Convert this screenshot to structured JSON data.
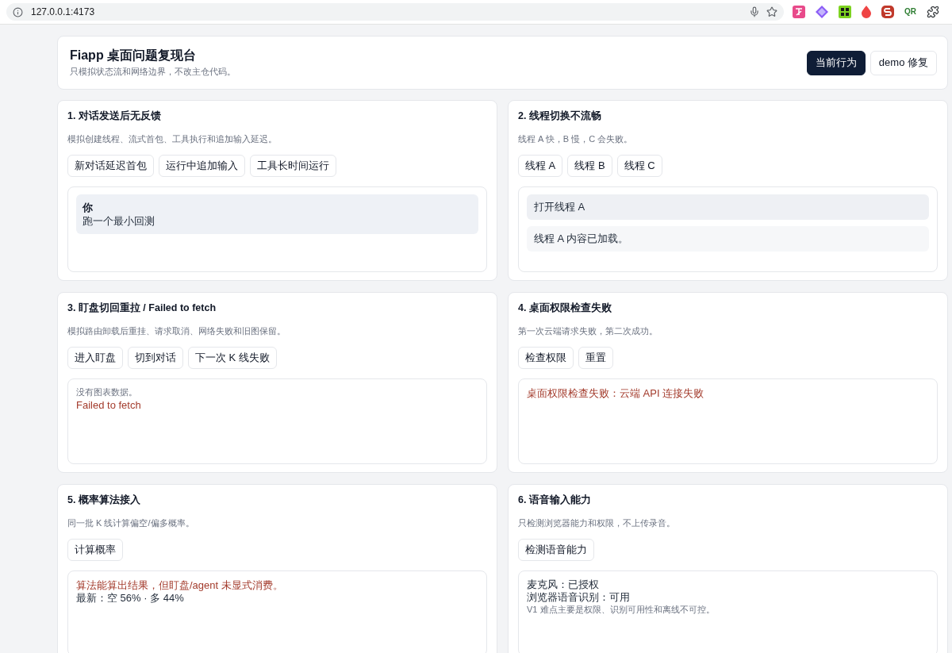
{
  "browser": {
    "url": "127.0.0.1:4173",
    "extension_label": "QR"
  },
  "header": {
    "title": "Fiapp 桌面问题复现台",
    "subtitle": "只模拟状态流和网络边界，不改主仓代码。",
    "mode_buttons": [
      {
        "label": "当前行为",
        "selected": true
      },
      {
        "label": "demo 修复",
        "selected": false
      }
    ]
  },
  "panels": [
    {
      "title": "1. 对话发送后无反馈",
      "description": "模拟创建线程、流式首包、工具执行和追加输入延迟。",
      "actions": [
        "新对话延迟首包",
        "运行中追加输入",
        "工具长时间运行"
      ],
      "output": [
        {
          "kind": "user_message",
          "author": "你",
          "text": "跑一个最小回测"
        }
      ]
    },
    {
      "title": "2. 线程切换不流畅",
      "description": "线程 A 快，B 慢，C 会失败。",
      "actions": [
        "线程 A",
        "线程 B",
        "线程 C"
      ],
      "output": [
        {
          "kind": "user_message",
          "text": "打开线程 A"
        },
        {
          "kind": "assistant_message",
          "text": "线程 A 内容已加载。"
        }
      ]
    },
    {
      "title": "3. 盯盘切回重拉 / Failed to fetch",
      "description": "模拟路由卸载后重挂、请求取消、网络失败和旧图保留。",
      "actions": [
        "进入盯盘",
        "切到对话",
        "下一次 K 线失败"
      ],
      "output": [
        {
          "kind": "note",
          "text": "没有图表数据。"
        },
        {
          "kind": "error",
          "text": "Failed to fetch"
        }
      ]
    },
    {
      "title": "4. 桌面权限检查失败",
      "description": "第一次云端请求失败，第二次成功。",
      "actions": [
        "检查权限",
        "重置"
      ],
      "output": [
        {
          "kind": "error",
          "text": "桌面权限检查失败：云端 API 连接失败"
        }
      ]
    },
    {
      "title": "5. 概率算法接入",
      "description": "同一批 K 线计算偏空/偏多概率。",
      "actions": [
        "计算概率"
      ],
      "output": [
        {
          "kind": "error",
          "text": "算法能算出结果，但盯盘/agent 未显式消费。"
        },
        {
          "kind": "line",
          "text": "最新：空 56% · 多 44%"
        }
      ]
    },
    {
      "title": "6. 语音输入能力",
      "description": "只检测浏览器能力和权限，不上传录音。",
      "actions": [
        "检测语音能力"
      ],
      "output": [
        {
          "kind": "line",
          "text": "麦克风：已授权"
        },
        {
          "kind": "line",
          "text": "浏览器语音识别：可用"
        },
        {
          "kind": "note",
          "text": "V1 难点主要是权限、识别可用性和离线不可控。"
        }
      ]
    }
  ]
}
